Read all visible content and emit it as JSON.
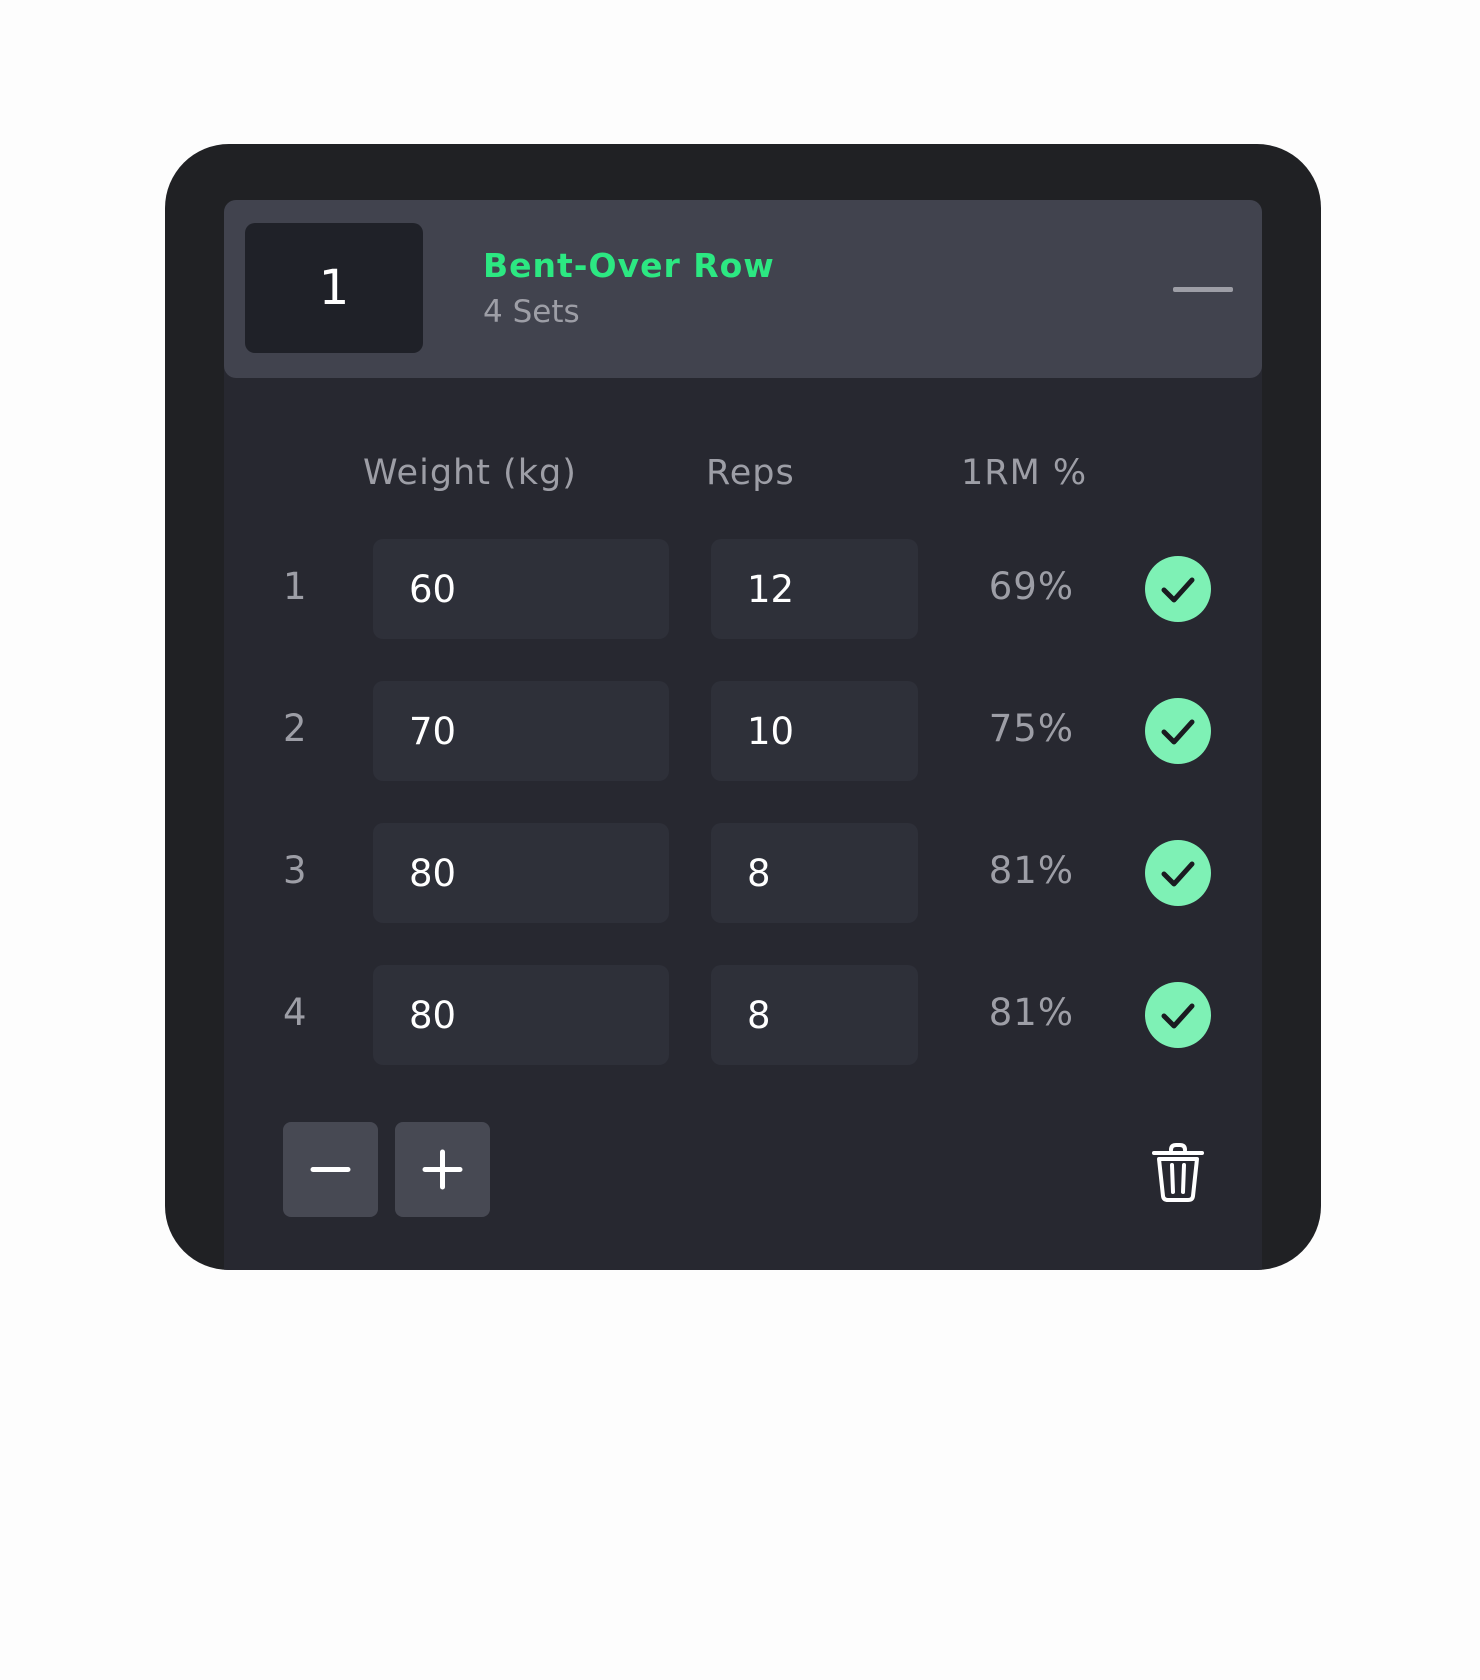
{
  "exercise": {
    "index": "1",
    "title": "Bent-Over Row",
    "subtitle": "4 Sets"
  },
  "columns": {
    "weight": "Weight (kg)",
    "reps": "Reps",
    "one_rm": "1RM %"
  },
  "sets": [
    {
      "number": "1",
      "weight": "60",
      "reps": "12",
      "one_rm_pct": "69%",
      "completed": true
    },
    {
      "number": "2",
      "weight": "70",
      "reps": "10",
      "one_rm_pct": "75%",
      "completed": true
    },
    {
      "number": "3",
      "weight": "80",
      "reps": "8",
      "one_rm_pct": "81%",
      "completed": true
    },
    {
      "number": "4",
      "weight": "80",
      "reps": "8",
      "one_rm_pct": "81%",
      "completed": true
    }
  ],
  "colors": {
    "accent": "#2ce882",
    "check": "#7ef1b5",
    "card": "#202124",
    "header": "#41434e",
    "field": "#2e3039"
  },
  "icons": {
    "collapse": "minus-line-icon",
    "check": "checkmark-icon",
    "remove_set": "minus-icon",
    "add_set": "plus-icon",
    "delete": "trash-icon"
  }
}
